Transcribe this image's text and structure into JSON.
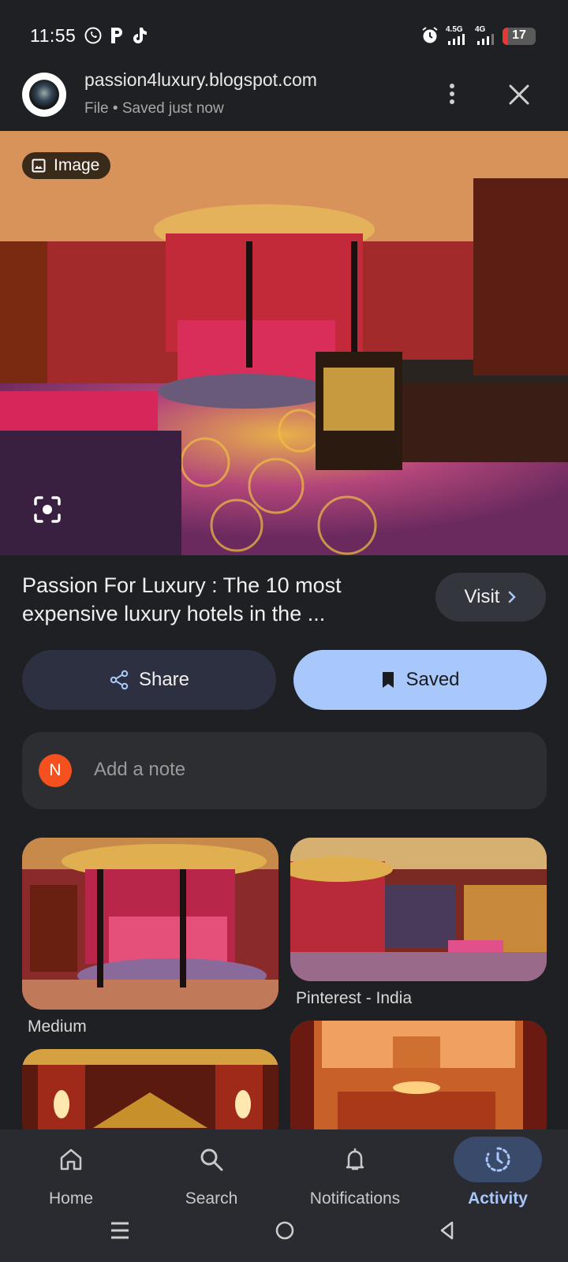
{
  "status_bar": {
    "time": "11:55",
    "app_icons": [
      "whatsapp-icon",
      "p-icon",
      "tiktok-icon"
    ],
    "net1": "4.5G",
    "net2": "4G",
    "battery": "17",
    "battery_level": 0.17
  },
  "header": {
    "site": "passion4luxury.blogspot.com",
    "subline": "File • Saved just now"
  },
  "hero": {
    "chip_label": "Image"
  },
  "result": {
    "title": "Passion For Luxury : The 10 most expensive luxury hotels in the ...",
    "visit_label": "Visit"
  },
  "actions": {
    "share_label": "Share",
    "saved_label": "Saved"
  },
  "note": {
    "avatar_letter": "N",
    "placeholder": "Add a note"
  },
  "related": [
    {
      "source": "Medium"
    },
    {
      "source": "Pinterest - India"
    }
  ],
  "nav": {
    "items": [
      {
        "label": "Home"
      },
      {
        "label": "Search"
      },
      {
        "label": "Notifications"
      },
      {
        "label": "Activity"
      }
    ],
    "active": "Activity"
  },
  "colors": {
    "background": "#1f2023",
    "accent": "#a8c7fa",
    "active_nav": "#a8c7fa"
  }
}
